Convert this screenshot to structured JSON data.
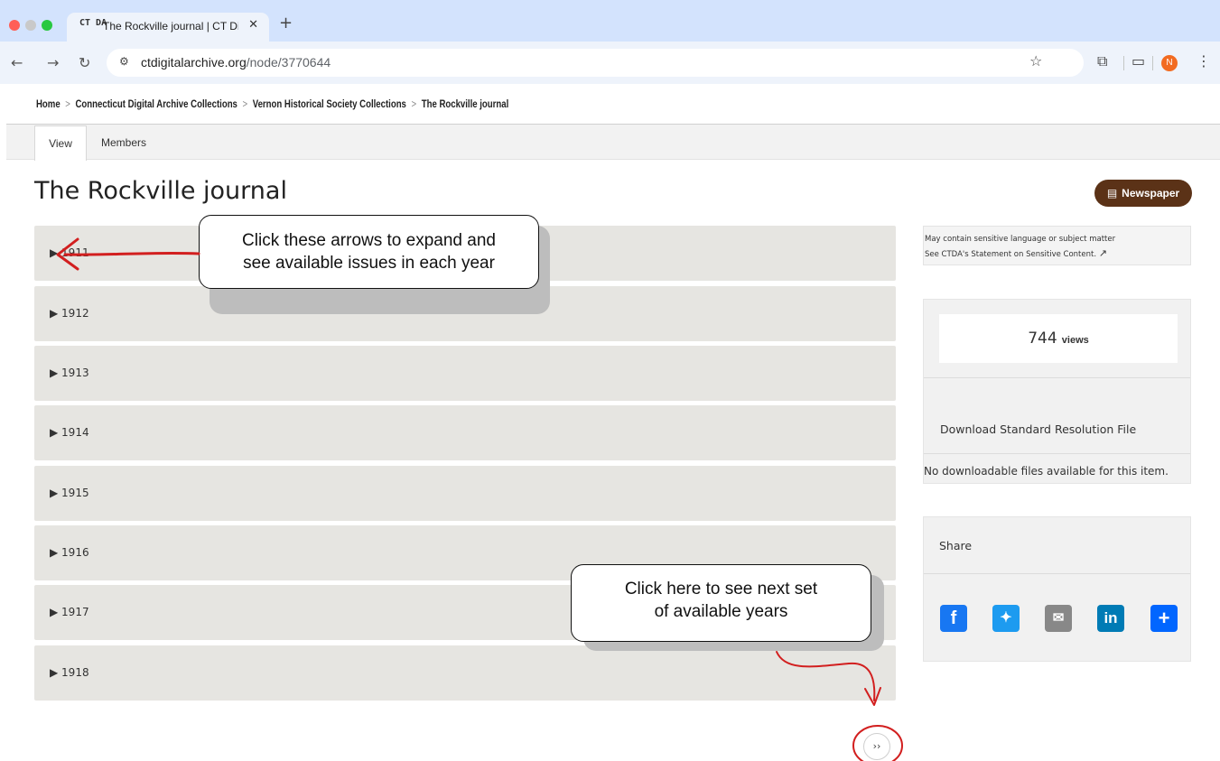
{
  "browser": {
    "tab_title": "The Rockville journal | CT Dig",
    "tab_favicon": "CT DA",
    "url_domain": "ctdigitalarchive.org",
    "url_path": "/node/3770644",
    "profile_initial": "N"
  },
  "breadcrumb": {
    "items": [
      "Home",
      "Connecticut Digital Archive Collections",
      "Vernon Historical Society Collections",
      "The Rockville journal"
    ],
    "separator": ">"
  },
  "page_tabs": [
    "View",
    "Members"
  ],
  "page_title": "The Rockville journal",
  "type_badge": "Newspaper",
  "years": [
    "▶ 1911",
    "▶ 1912",
    "▶ 1913",
    "▶ 1914",
    "▶ 1915",
    "▶ 1916",
    "▶ 1917",
    "▶ 1918"
  ],
  "notice": {
    "line1": "May contain sensitive language or subject matter",
    "line2": "See CTDA's Statement on Sensitive Content."
  },
  "views": {
    "count": "744",
    "label": "views"
  },
  "download": {
    "label": "Download Standard Resolution File",
    "none_text": "No downloadable files available for this item."
  },
  "share": {
    "label": "Share",
    "icons": [
      "facebook-icon",
      "twitter-icon",
      "email-icon",
      "linkedin-icon",
      "addtoany-icon"
    ]
  },
  "pager_next": "››",
  "annotations": {
    "callout1_line1": "Click these arrows to expand and",
    "callout1_line2": "see available issues in each year",
    "callout2_line1": "Click here to see next set",
    "callout2_line2": "of available years",
    "arrow_color": "#d21f1f"
  },
  "colors": {
    "badge": "#5b3217",
    "row_bg": "#e6e5e1",
    "chrome_tab": "#d3e3fd"
  }
}
